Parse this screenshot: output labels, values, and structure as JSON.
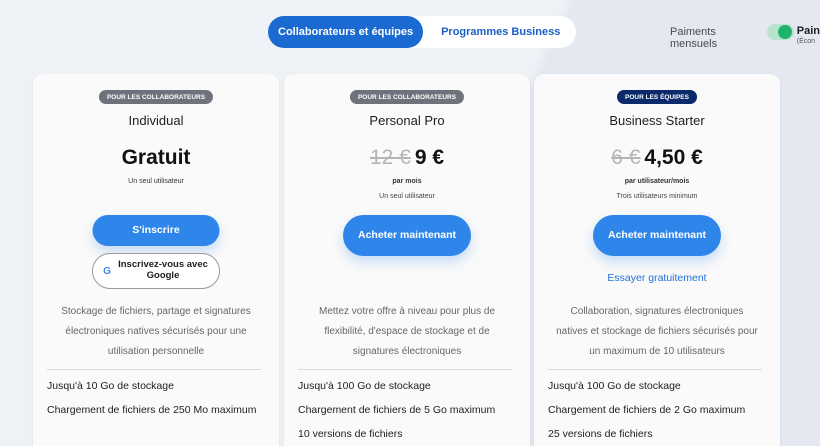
{
  "tabs": [
    {
      "label": "Collaborateurs et équipes",
      "active": true
    },
    {
      "label": "Programmes Business",
      "active": false
    }
  ],
  "billing": {
    "label": "Paiments mensuels",
    "toggle_on": true,
    "alt_label": "Pain",
    "alt_sub": "(Écon"
  },
  "colors": {
    "primary_button": "#2f86ea",
    "tab_active": "#1b6ad1",
    "toggle": "#20b36b",
    "badge_grey": "#6d727b",
    "badge_navy": "#0b2a6b"
  },
  "plans": [
    {
      "badge": "POUR LES COLLABORATEURS",
      "name": "Individual",
      "price": "Gratuit",
      "sub1": "Un seul utilisateur",
      "cta": "S'inscrire",
      "google_cta": "Inscrivez-vous avec Google",
      "google_icon": "google-icon",
      "description": "Stockage de fichiers, partage et signatures électroniques natives sécurisés pour une utilisation personnelle",
      "features": [
        "Jusqu'à 10 Go de stockage",
        "Chargement de fichiers de 250 Mo maximum"
      ]
    },
    {
      "badge": "POUR LES COLLABORATEURS",
      "name": "Personal Pro",
      "old_price": "12 €",
      "price": "9 €",
      "sub1": "par mois",
      "sub2": "Un seul utilisateur",
      "cta": "Acheter maintenant",
      "description": "Mettez votre offre à niveau pour plus de flexibilité, d'espace de stockage et de signatures électroniques",
      "features": [
        "Jusqu'à 100 Go de stockage",
        "Chargement de fichiers de 5 Go maximum",
        "10 versions de fichiers"
      ]
    },
    {
      "badge": "POUR LES ÉQUIPES",
      "name": "Business Starter",
      "old_price": "6 €",
      "price": "4,50 €",
      "sub1": "par utilisateur/mois",
      "sub2": "Trois utilisateurs minimum",
      "cta": "Acheter maintenant",
      "trial": "Essayer gratuitement",
      "description": "Collaboration, signatures électroniques natives et stockage de fichiers sécurisés pour un maximum de 10 utilisateurs",
      "features": [
        "Jusqu'à 100 Go de stockage",
        "Chargement de fichiers de 2 Go maximum",
        "25 versions de fichiers"
      ]
    }
  ]
}
